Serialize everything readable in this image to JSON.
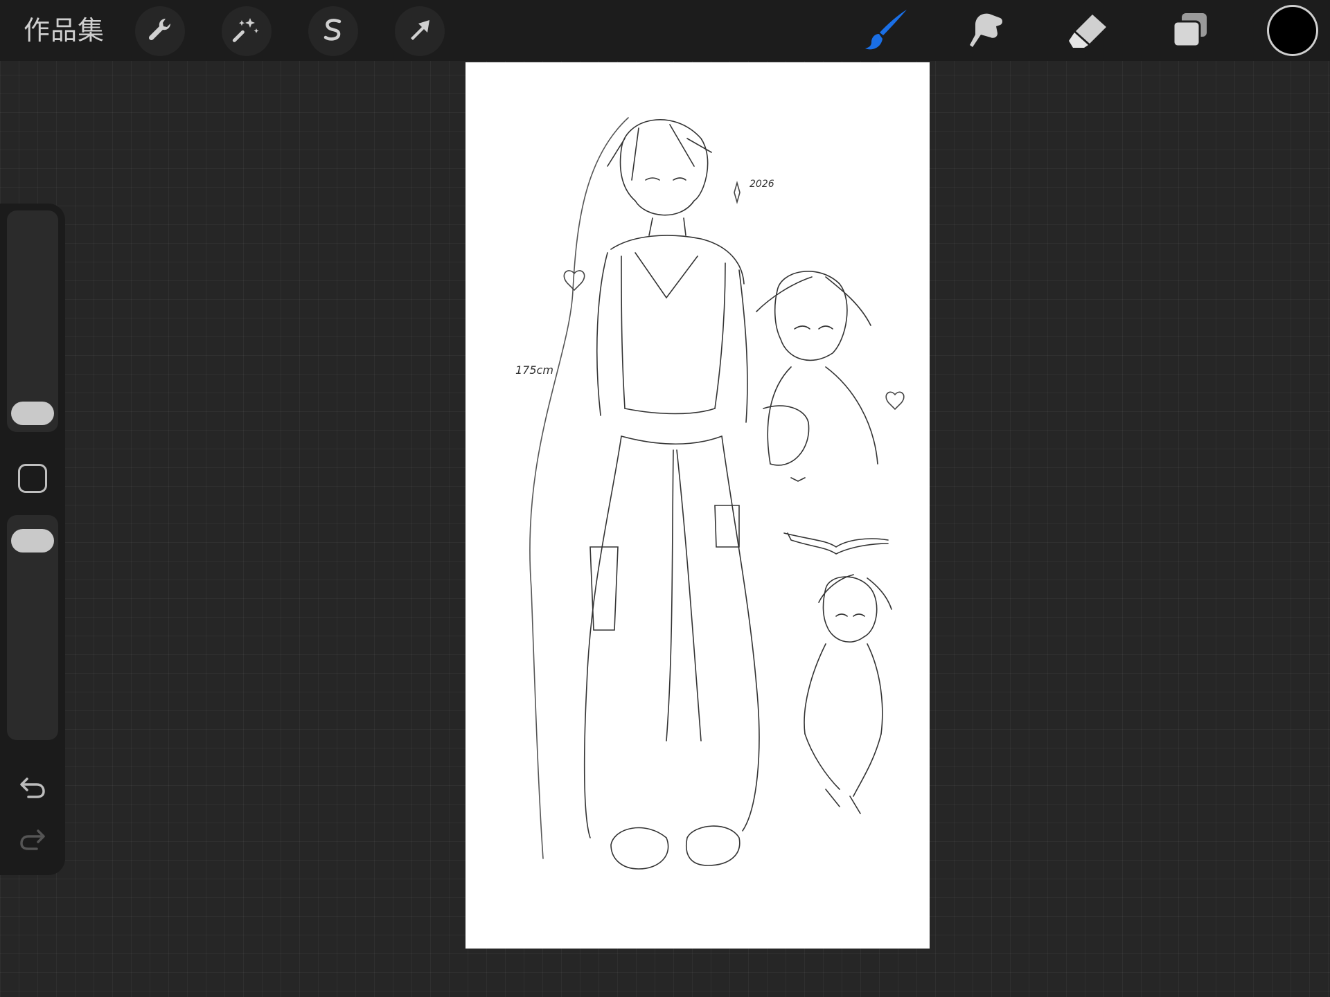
{
  "topbar": {
    "gallery_label": "作品集",
    "left_tools": [
      {
        "name": "actions",
        "icon": "wrench-icon"
      },
      {
        "name": "adjustments",
        "icon": "magic-wand-icon"
      },
      {
        "name": "selection",
        "icon": "selection-s-icon"
      },
      {
        "name": "transform",
        "icon": "arrow-cursor-icon"
      }
    ],
    "right_tools": [
      {
        "name": "brush",
        "icon": "brush-icon",
        "active": true
      },
      {
        "name": "smudge",
        "icon": "smudge-finger-icon"
      },
      {
        "name": "eraser",
        "icon": "eraser-icon"
      },
      {
        "name": "layers",
        "icon": "layers-icon"
      }
    ],
    "current_color": "#000000",
    "active_color": "#1a6fe6"
  },
  "canvas": {
    "sketch_notes": {
      "date_note": "2026",
      "height_note": "175cm"
    }
  },
  "sidebar": {
    "brush_size_icon": "size-slider",
    "opacity_icon": "opacity-slider",
    "modify_icon": "square-modify-icon",
    "undo_icon": "undo-icon",
    "redo_icon": "redo-icon"
  }
}
